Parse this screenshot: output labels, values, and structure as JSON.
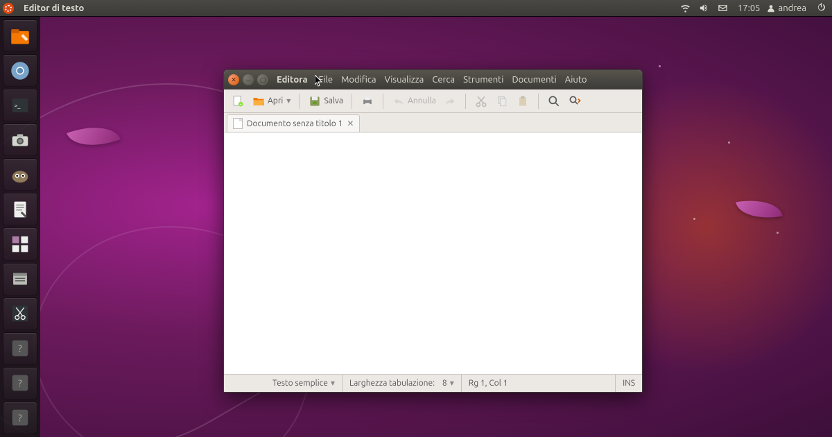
{
  "panel": {
    "app_name": "Editor di testo",
    "clock": "17:05",
    "username": "andrea"
  },
  "launcher": {
    "items": [
      {
        "name": "files"
      },
      {
        "name": "chromium"
      },
      {
        "name": "terminal"
      },
      {
        "name": "camera"
      },
      {
        "name": "gimp"
      },
      {
        "name": "gedit"
      },
      {
        "name": "workspace"
      },
      {
        "name": "filemanager"
      },
      {
        "name": "cut-tool"
      },
      {
        "name": "placeholder1"
      },
      {
        "name": "placeholder2"
      },
      {
        "name": "placeholder3"
      }
    ]
  },
  "window": {
    "title": "Editora",
    "menu": {
      "file": "File",
      "edit": "Modifica",
      "view": "Visualizza",
      "search": "Cerca",
      "tools": "Strumenti",
      "documents": "Documenti",
      "help": "Aiuto"
    },
    "toolbar": {
      "open": "Apri",
      "save": "Salva",
      "undo": "Annulla"
    },
    "tab": {
      "label": "Documento senza titolo 1"
    },
    "status": {
      "syntax": "Testo semplice",
      "tabwidth_label": "Larghezza tabulazione:",
      "tabwidth_value": "8",
      "cursor": "Rg 1, Col 1",
      "mode": "INS"
    }
  }
}
